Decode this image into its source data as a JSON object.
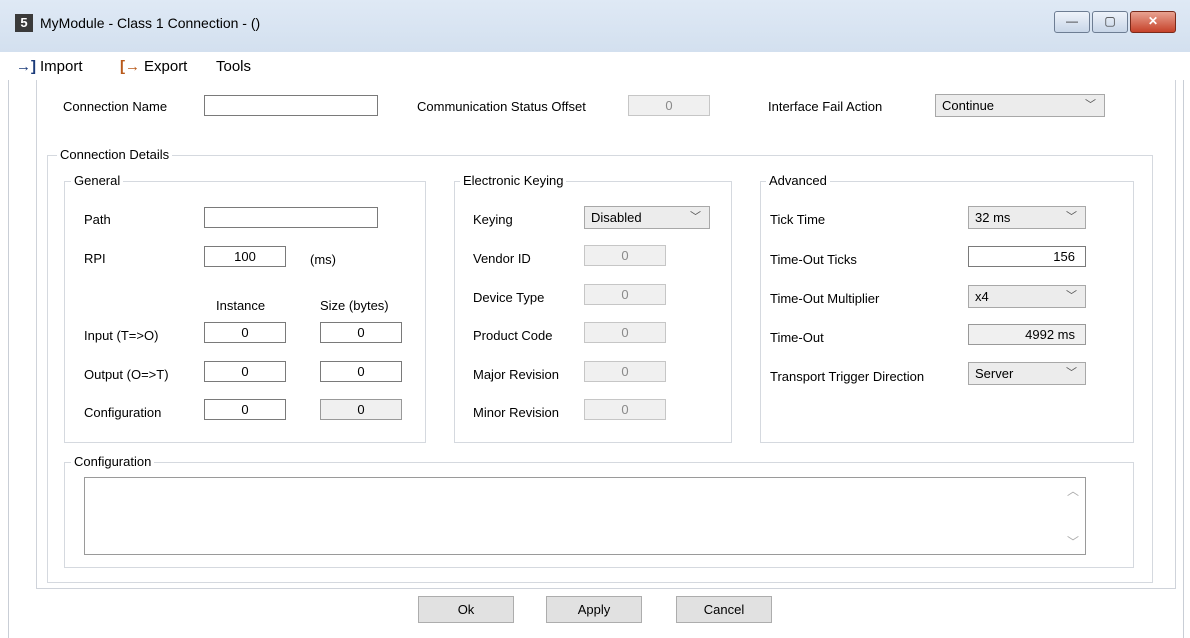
{
  "window": {
    "title": "MyModule - Class 1 Connection -  ()",
    "app_icon_letter": "5",
    "minimize_glyph": "—",
    "maximize_glyph": "▢",
    "close_glyph": "✕"
  },
  "menu": {
    "import_label": "Import",
    "import_glyph": "→]",
    "export_label": "Export",
    "export_glyph": "[→",
    "tools_label": "Tools"
  },
  "top": {
    "connection_name_label": "Connection Name",
    "connection_name_value": "",
    "comm_status_offset_label": "Communication Status Offset",
    "comm_status_offset_value": "0",
    "interface_fail_action_label": "Interface Fail Action",
    "interface_fail_action_value": "Continue"
  },
  "connection_details": {
    "title": "Connection Details",
    "general": {
      "title": "General",
      "path_label": "Path",
      "path_value": "",
      "rpi_label": "RPI",
      "rpi_value": "100",
      "rpi_unit": "(ms)",
      "instance_header": "Instance",
      "size_header": "Size (bytes)",
      "input_label": "Input (T=>O)",
      "input_instance": "0",
      "input_size": "0",
      "output_label": "Output (O=>T)",
      "output_instance": "0",
      "output_size": "0",
      "config_label": "Configuration",
      "config_instance": "0",
      "config_size": "0"
    },
    "keying": {
      "title": "Electronic Keying",
      "keying_label": "Keying",
      "keying_value": "Disabled",
      "vendor_id_label": "Vendor ID",
      "vendor_id_value": "0",
      "device_type_label": "Device Type",
      "device_type_value": "0",
      "product_code_label": "Product Code",
      "product_code_value": "0",
      "major_revision_label": "Major Revision",
      "major_revision_value": "0",
      "minor_revision_label": "Minor Revision",
      "minor_revision_value": "0"
    },
    "advanced": {
      "title": "Advanced",
      "tick_time_label": "Tick Time",
      "tick_time_value": "32 ms",
      "timeout_ticks_label": "Time-Out Ticks",
      "timeout_ticks_value": "156",
      "timeout_multiplier_label": "Time-Out Multiplier",
      "timeout_multiplier_value": "x4",
      "timeout_label": "Time-Out",
      "timeout_value": "4992 ms",
      "transport_trigger_label": "Transport Trigger Direction",
      "transport_trigger_value": "Server"
    },
    "configuration": {
      "title": "Configuration",
      "value": ""
    }
  },
  "buttons": {
    "ok": "Ok",
    "apply": "Apply",
    "cancel": "Cancel"
  },
  "icons": {
    "chevron": "chevron-down-icon",
    "scroll_up": "scroll-up-icon",
    "scroll_down": "scroll-down-icon"
  }
}
